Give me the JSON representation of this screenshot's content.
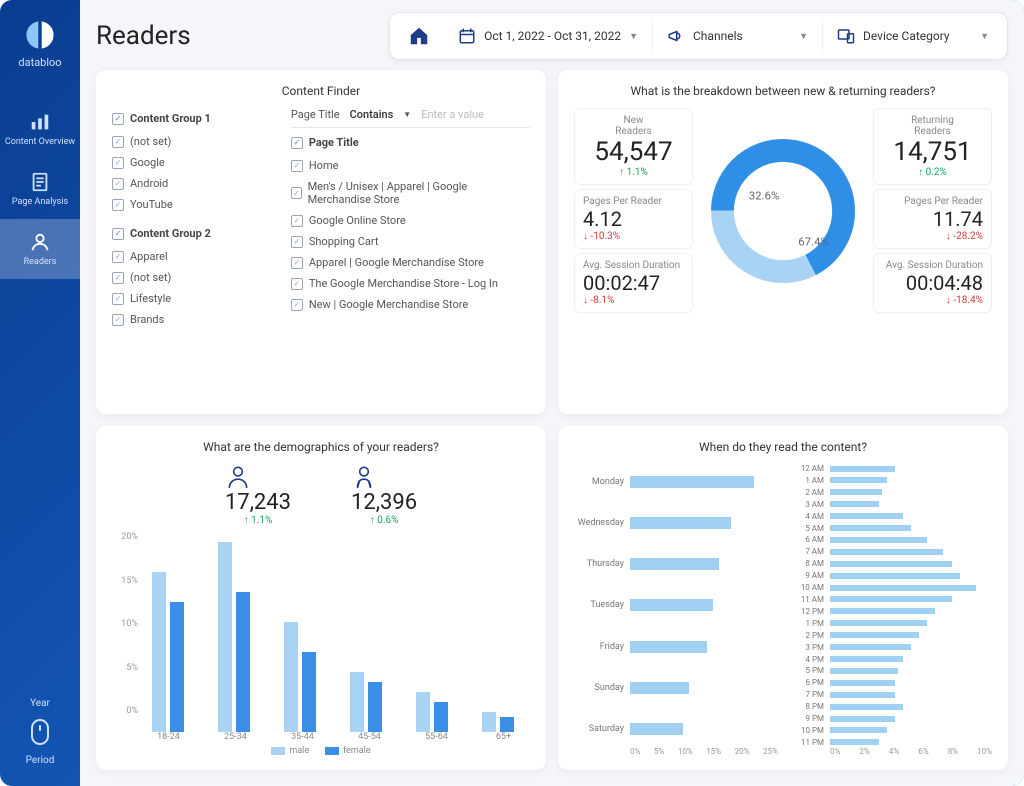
{
  "brand": "databloo",
  "page_title": "Readers",
  "sidebar": {
    "items": [
      {
        "label": "Content Overview"
      },
      {
        "label": "Page Analysis"
      },
      {
        "label": "Readers"
      }
    ],
    "toggle_year": "Year",
    "toggle_period": "Period"
  },
  "filters": {
    "date_range": "Oct 1, 2022 - Oct 31, 2022",
    "channels_label": "Channels",
    "device_label": "Device Category"
  },
  "content_finder": {
    "title": "Content Finder",
    "group1_title": "Content Group 1",
    "group1_items": [
      "(not set)",
      "Google",
      "Android",
      "YouTube"
    ],
    "group2_title": "Content Group 2",
    "group2_items": [
      "Apparel",
      "(not set)",
      "Lifestyle",
      "Brands"
    ],
    "filter_field": "Page Title",
    "filter_op": "Contains",
    "filter_placeholder": "Enter a value",
    "page_title_heading": "Page Title",
    "pages": [
      "Home",
      "Men's / Unisex | Apparel | Google Merchandise Store",
      "Google Online Store",
      "Shopping Cart",
      "Apparel | Google Merchandise Store",
      "The Google Merchandise Store - Log In",
      "New | Google Merchandise Store"
    ]
  },
  "nvr": {
    "title": "What is the breakdown between new & returning readers?",
    "new_label": "New\nReaders",
    "new_value": "54,547",
    "new_delta": "1.1%",
    "ppr_label": "Pages Per Reader",
    "new_ppr": "4.12",
    "new_ppr_delta": "-10.3%",
    "asd_label": "Avg. Session Duration",
    "new_asd": "00:02:47",
    "new_asd_delta": "-8.1%",
    "ret_label": "Returning\nReaders",
    "ret_value": "14,751",
    "ret_delta": "0.2%",
    "ret_ppr": "11.74",
    "ret_ppr_delta": "-28.2%",
    "ret_asd": "00:04:48",
    "ret_asd_delta": "-18.4%",
    "donut_new_pct": "67.4%",
    "donut_ret_pct": "32.6%"
  },
  "demo": {
    "title": "What are the demographics of your readers?",
    "male_count": "17,243",
    "male_delta": "1.1%",
    "female_count": "12,396",
    "female_delta": "0.6%",
    "legend_male": "male",
    "legend_female": "female"
  },
  "when": {
    "title": "When do they read the content?"
  },
  "chart_data": [
    {
      "type": "pie",
      "title": "New vs Returning Readers",
      "series": [
        {
          "name": "New Readers",
          "value": 67.4
        },
        {
          "name": "Returning Readers",
          "value": 32.6
        }
      ]
    },
    {
      "type": "bar",
      "title": "Reader demographics by age bracket (%)",
      "categories": [
        "18-24",
        "25-34",
        "35-44",
        "45-54",
        "55-64",
        "65+"
      ],
      "series": [
        {
          "name": "male",
          "values": [
            16,
            19,
            11,
            6,
            4,
            2
          ]
        },
        {
          "name": "female",
          "values": [
            13,
            14,
            8,
            5,
            3,
            1.5
          ]
        }
      ],
      "ylabel": "%",
      "ylim": [
        0,
        20
      ],
      "yticks": [
        0,
        5,
        10,
        15,
        20
      ]
    },
    {
      "type": "bar",
      "orientation": "horizontal",
      "title": "Content reads by day of week (%)",
      "categories": [
        "Monday",
        "Wednesday",
        "Thursday",
        "Tuesday",
        "Friday",
        "Sunday",
        "Saturday"
      ],
      "values": [
        21,
        17,
        15,
        14,
        13,
        10,
        9
      ],
      "xlim": [
        0,
        25
      ],
      "xticks": [
        0,
        5,
        10,
        15,
        20,
        25
      ]
    },
    {
      "type": "bar",
      "orientation": "horizontal",
      "title": "Content reads by hour of day (%)",
      "categories": [
        "12 AM",
        "1 AM",
        "2 AM",
        "3 AM",
        "4 AM",
        "5 AM",
        "6 AM",
        "7 AM",
        "8 AM",
        "9 AM",
        "10 AM",
        "11 AM",
        "12 PM",
        "1 PM",
        "2 PM",
        "3 PM",
        "4 PM",
        "5 PM",
        "6 PM",
        "7 PM",
        "8 PM",
        "9 PM",
        "10 PM",
        "11 PM"
      ],
      "values": [
        4.0,
        3.5,
        3.2,
        3.0,
        4.5,
        5.0,
        6.0,
        7.0,
        7.5,
        8.0,
        9.0,
        7.5,
        6.5,
        6.0,
        5.5,
        5.0,
        4.5,
        4.2,
        4.0,
        4.0,
        4.5,
        4.0,
        3.5,
        3.0
      ],
      "xlim": [
        0,
        10
      ],
      "xticks": [
        0,
        2,
        4,
        6,
        8,
        10
      ]
    }
  ]
}
